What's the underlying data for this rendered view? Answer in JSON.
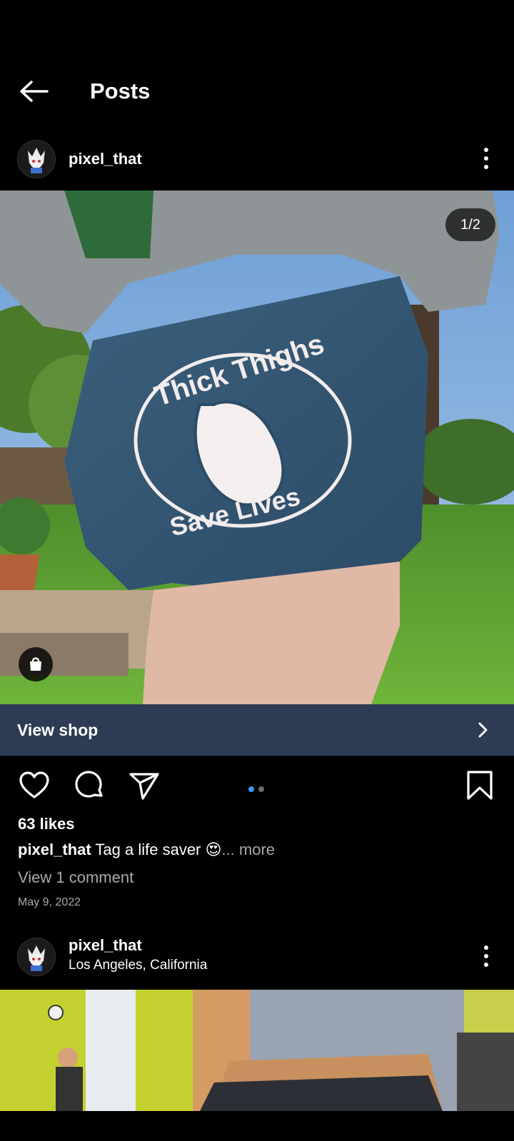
{
  "header": {
    "title": "Posts"
  },
  "post1": {
    "username": "pixel_that",
    "counter": "1/2",
    "view_shop": "View shop",
    "likes": "63 likes",
    "caption_user": "pixel_that",
    "caption_text": "Tag a life saver 😍",
    "caption_more": "... more",
    "comments": "View 1 comment",
    "date": "May 9, 2022",
    "shorts_print_top": "Thick Thighs",
    "shorts_print_bottom": "Save Lives",
    "carousel": {
      "count": 2,
      "active": 1
    }
  },
  "post2": {
    "username": "pixel_that",
    "location": "Los Angeles, California"
  },
  "colors": {
    "background": "#000000",
    "view_shop_bar": "#2d3b54",
    "active_dot": "#3897f0",
    "muted_text": "#a8a8a8"
  },
  "icons": [
    "back-arrow-icon",
    "more-vert-icon",
    "shopping-bag-icon",
    "chevron-right-icon",
    "heart-icon",
    "comment-icon",
    "send-icon",
    "bookmark-icon"
  ]
}
